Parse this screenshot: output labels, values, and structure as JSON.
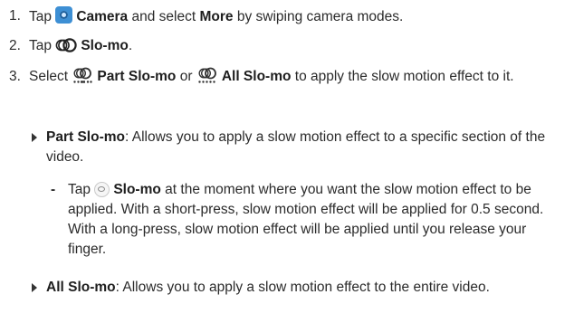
{
  "steps": [
    {
      "num": "1.",
      "t1": "Tap",
      "icon": "camera-icon",
      "b1": "Camera",
      "t2": "and select",
      "b2": "More",
      "t3": "by swiping camera modes."
    },
    {
      "num": "2.",
      "t1": "Tap",
      "icon": "slo-mo-icon",
      "b1": "Slo-mo",
      "t2": "."
    },
    {
      "num": "3.",
      "t1": "Select",
      "icon1": "part-slo-mo-icon",
      "b1": "Part Slo-mo",
      "t2": "or",
      "icon2": "all-slo-mo-icon",
      "b2": "All Slo-mo",
      "t3": "to apply the slow motion effect to it."
    }
  ],
  "part_slo_mo": {
    "b": "Part Slo-mo",
    "t": ": Allows you to apply a slow motion effect to a specific section of the video."
  },
  "part_slo_mo_detail": {
    "dash": "-",
    "t1": "Tap",
    "icon": "slo-mo-record-icon",
    "b": "Slo-mo",
    "t2": "at the moment where you want the slow motion effect to be applied. With a short-press, slow motion effect will be applied for 0.5 second. With a long-press, slow motion effect will be applied until you release your finger."
  },
  "all_slo_mo": {
    "b": "All Slo-mo",
    "t": ": Allows you to apply a slow motion effect to the entire video."
  }
}
